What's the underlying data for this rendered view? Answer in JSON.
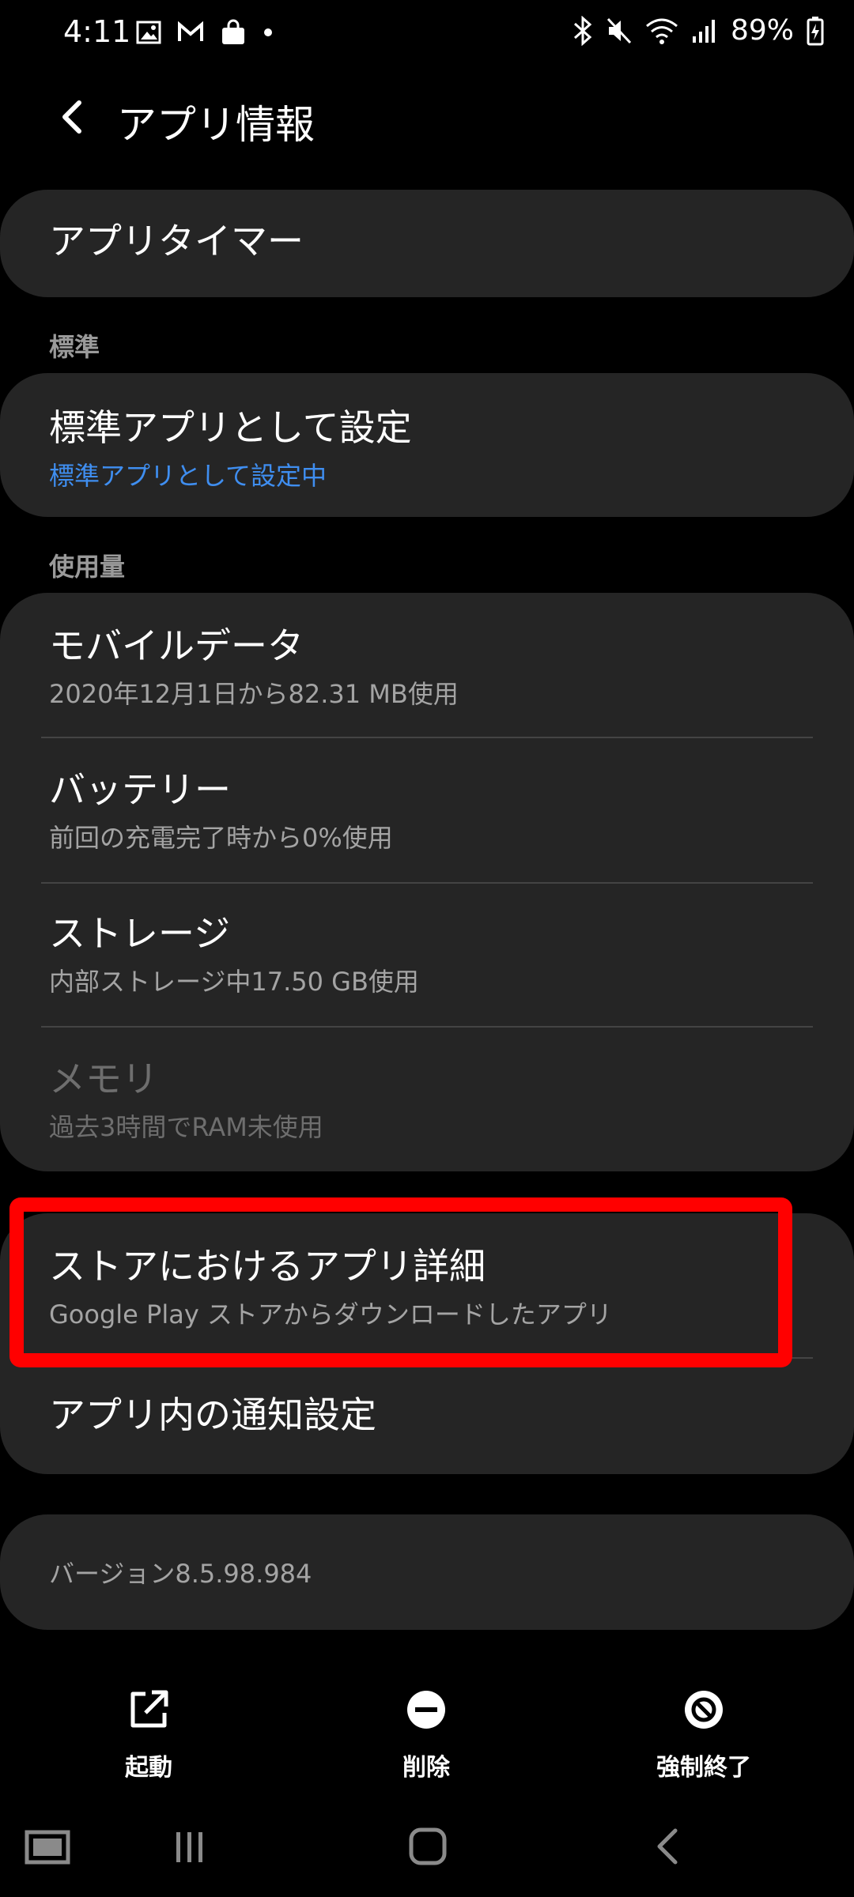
{
  "status_bar": {
    "time": "4:11",
    "battery_percent": "89%"
  },
  "app_bar": {
    "title": "アプリ情報"
  },
  "app_timer": {
    "label": "アプリタイマー"
  },
  "sections": {
    "default": "標準",
    "usage": "使用量"
  },
  "default_app": {
    "title": "標準アプリとして設定",
    "subtitle": "標準アプリとして設定中"
  },
  "usage_items": [
    {
      "title": "モバイルデータ",
      "subtitle": "2020年12月1日から82.31 MB使用"
    },
    {
      "title": "バッテリー",
      "subtitle": "前回の充電完了時から0%使用"
    },
    {
      "title": "ストレージ",
      "subtitle": "内部ストレージ中17.50 GB使用"
    },
    {
      "title": "メモリ",
      "subtitle": "過去3時間でRAM未使用"
    }
  ],
  "store": {
    "title": "ストアにおけるアプリ詳細",
    "subtitle": "Google Play ストアからダウンロードしたアプリ"
  },
  "notification": {
    "title": "アプリ内の通知設定"
  },
  "version": {
    "text": "バージョン8.5.98.984"
  },
  "actions": {
    "open": "起動",
    "uninstall": "削除",
    "force_stop": "強制終了"
  },
  "colors": {
    "highlight": "#ff0000",
    "link_blue": "#3f8ef0",
    "card_bg": "#252525"
  }
}
